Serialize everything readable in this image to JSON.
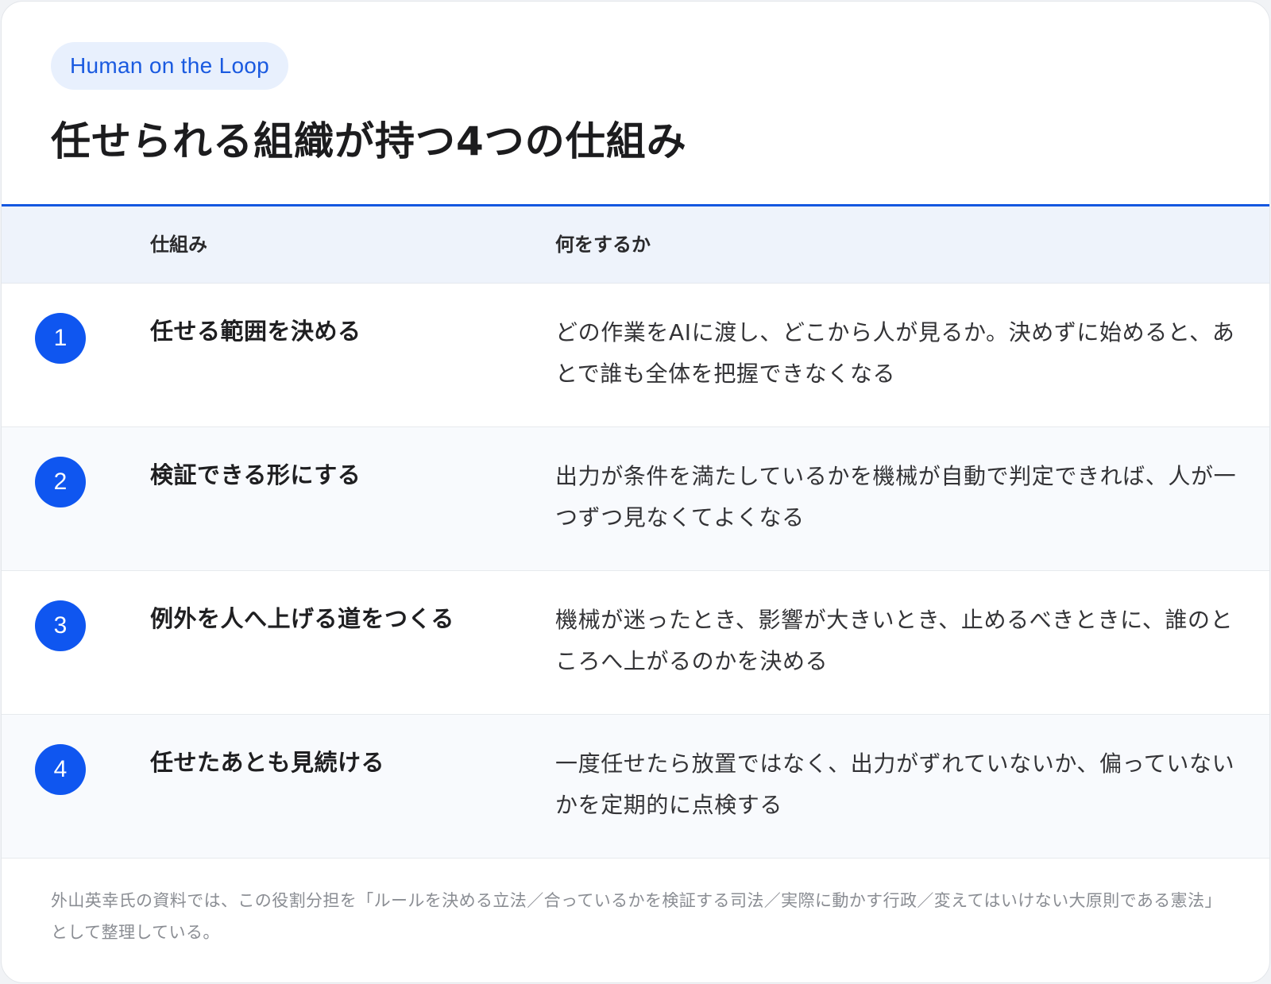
{
  "header": {
    "badge": "Human on the Loop",
    "title": "任せられる組織が持つ4つの仕組み"
  },
  "table": {
    "columns": [
      "仕組み",
      "何をするか"
    ],
    "rows": [
      {
        "number": "1",
        "mechanism": "任せる範囲を決める",
        "description": "どの作業をAIに渡し、どこから人が見るか。決めずに始めると、あとで誰も全体を把握できなくなる"
      },
      {
        "number": "2",
        "mechanism": "検証できる形にする",
        "description": "出力が条件を満たしているかを機械が自動で判定できれば、人が一つずつ見なくてよくなる"
      },
      {
        "number": "3",
        "mechanism": "例外を人へ上げる道をつくる",
        "description": "機械が迷ったとき、影響が大きいとき、止めるべきときに、誰のところへ上がるのかを決める"
      },
      {
        "number": "4",
        "mechanism": "任せたあとも見続ける",
        "description": "一度任せたら放置ではなく、出力がずれていないか、偏っていないかを定期的に点検する"
      }
    ]
  },
  "footer": {
    "note": "外山英幸氏の資料では、この役割分担を「ルールを決める立法／合っているかを検証する司法／実際に動かす行政／変えてはいけない大原則である憲法」として整理している。"
  },
  "colors": {
    "accent": "#1457e0",
    "badge_bg": "#e8f0fd",
    "number_circle": "#0f56f0",
    "header_row_bg": "#eef3fb"
  }
}
